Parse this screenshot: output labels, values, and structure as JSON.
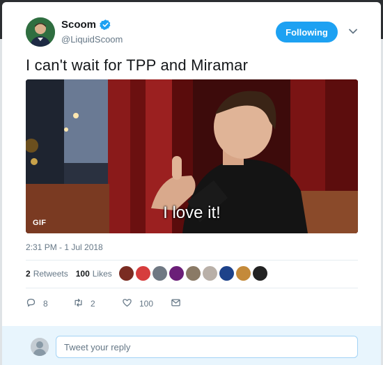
{
  "tweet": {
    "display_name": "Scoom",
    "handle": "@LiquidScoom",
    "follow_label": "Following",
    "text": "I can't wait for TPP and Miramar",
    "media": {
      "badge": "GIF",
      "caption": "I love it!"
    },
    "timestamp": "2:31 PM - 1 Jul 2018",
    "stats": {
      "retweets_count": "2",
      "retweets_label": "Retweets",
      "likes_count": "100",
      "likes_label": "Likes"
    },
    "likers": [
      "#7a2c22",
      "#d63d3d",
      "#6f7883",
      "#6b1f78",
      "#8a7a66",
      "#b9b0a8",
      "#1d428a",
      "#c48a3a",
      "#222222"
    ],
    "actions": {
      "reply_count": "8",
      "retweet_count": "2",
      "like_count": "100"
    }
  },
  "reply": {
    "placeholder": "Tweet your reply"
  },
  "colors": {
    "accent": "#1da1f2",
    "muted": "#657786",
    "text": "#14171a"
  },
  "icons": [
    "verified-icon",
    "chevron-down-icon",
    "reply-icon",
    "retweet-icon",
    "heart-icon",
    "direct-message-icon"
  ]
}
